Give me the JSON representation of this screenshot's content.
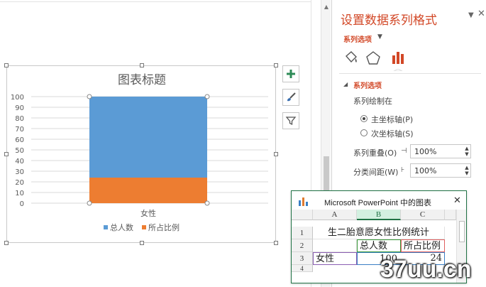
{
  "chart": {
    "title": "图表标题",
    "xlabel": "女性",
    "legend": [
      "总人数",
      "所占比例"
    ]
  },
  "chart_data": {
    "type": "bar",
    "stacked": true,
    "categories": [
      "女性"
    ],
    "series": [
      {
        "name": "所占比例",
        "values": [
          24
        ],
        "color": "#ed7d31"
      },
      {
        "name": "总人数",
        "values": [
          100
        ],
        "color": "#5b9bd5"
      }
    ],
    "title": "图表标题",
    "xlabel": "",
    "ylabel": "",
    "ylim": [
      0,
      100
    ],
    "yticks": [
      0,
      10,
      20,
      30,
      40,
      50,
      60,
      70,
      80,
      90,
      100
    ],
    "grid": true,
    "legend_position": "bottom"
  },
  "side_buttons": {
    "elements_icon": "plus-icon",
    "styles_icon": "brush-icon",
    "filter_icon": "filter-icon"
  },
  "pane": {
    "title": "设置数据系列格式",
    "subtitle": "系列选项",
    "section": "系列选项",
    "plot_on": "系列绘制在",
    "primary_axis": "主坐标轴(P)",
    "secondary_axis": "次坐标轴(S)",
    "overlap_label": "系列重叠(O)",
    "overlap_value": "100%",
    "gap_label": "分类间距(W)",
    "gap_value": "100%",
    "accent": "#d24726"
  },
  "excel": {
    "title": "Microsoft PowerPoint 中的图表",
    "columns": [
      "A",
      "B",
      "C"
    ],
    "rows": [
      "1",
      "2",
      "3",
      "4"
    ],
    "cells": {
      "r1": "生二胎意愿女性比例统计",
      "r2b": "总人数",
      "r2c": "所占比例",
      "r3a": "女性",
      "r3b": "100",
      "r3c": "24"
    }
  },
  "watermark": "37uu.cn"
}
